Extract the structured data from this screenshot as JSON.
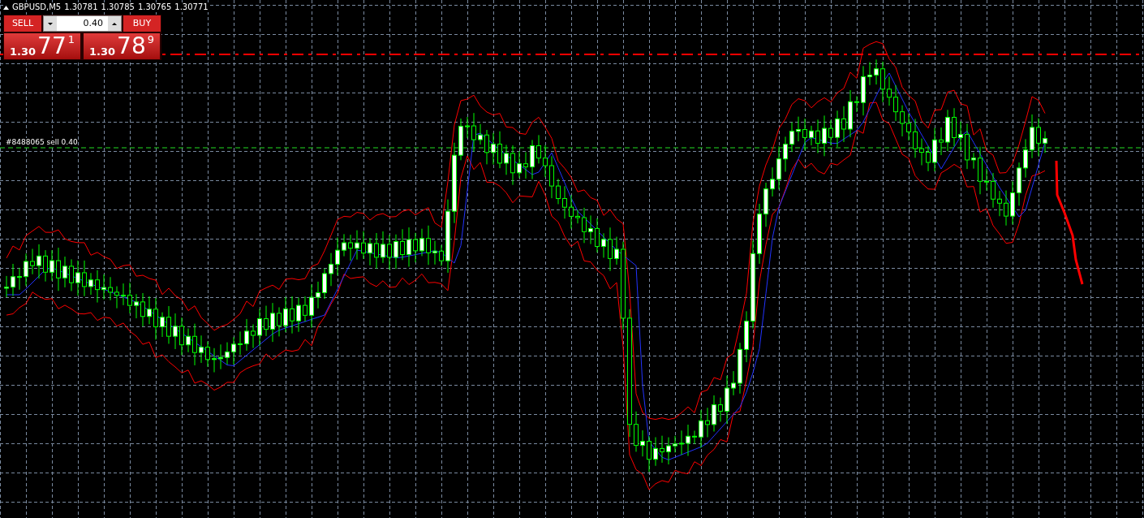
{
  "chart_header": {
    "symbol": "GBPUSD,M5",
    "quotes": [
      "1.30781",
      "1.30785",
      "1.30765",
      "1.30771"
    ]
  },
  "trade_panel": {
    "sell": {
      "label": "SELL",
      "big": "1.30",
      "main": "77",
      "pip": "1"
    },
    "volume": "0.40",
    "buy": {
      "label": "BUY",
      "big": "1.30",
      "main": "78",
      "pip": "9"
    }
  },
  "order_line": {
    "label": "#8488065 sell 0.40"
  }
}
